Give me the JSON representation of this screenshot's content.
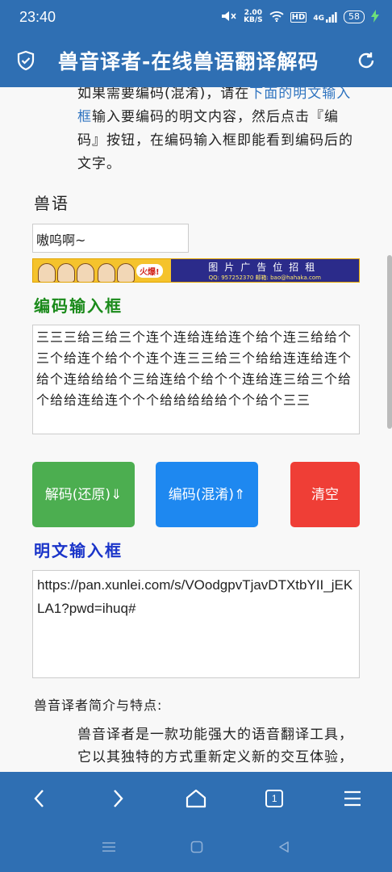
{
  "status": {
    "time": "23:40",
    "speed_value": "2.00",
    "speed_unit": "KB/S",
    "hd": "HD",
    "signal": "4G",
    "battery": "58"
  },
  "header": {
    "title": "兽音译者-在线兽语翻译解码"
  },
  "intro": {
    "part1": "如果需要编码(混淆)，请在",
    "link": "下面的明文输入框",
    "part2": "输入要编码的明文内容，然后点击『编码』按钮，在编码输入框即能看到编码后的文字。"
  },
  "beast_section": {
    "label": "兽语",
    "input_value": "嗷呜啊~"
  },
  "ad": {
    "hot": "火爆!",
    "text": "图片广告位招租",
    "contact": "QQ: 957252370  邮箱: bao@hahaka.com"
  },
  "encoded_section": {
    "label": "编码输入框",
    "value": "三三三给三给三个连个连给连给连个给个连三给给个三个给连个给个个连个连三三给三个给给连连给连个给个连给给给个三给连给个给个个连给连三给三个给个给给连给连个个个给给给给给个个给个三三"
  },
  "buttons": {
    "decode": "解码(还原)⇓",
    "encode": "编码(混淆)⇑",
    "clear": "清空"
  },
  "plain_section": {
    "label": "明文输入框",
    "value": "https://pan.xunlei.com/s/VOodgpvTjavDTXtbYII_jEKLA1?pwd=ihuq#"
  },
  "features": {
    "title": "兽音译者简介与特点:",
    "body": "兽音译者是一款功能强大的语音翻译工具，它以其独特的方式重新定义新的交互体验，带来全新的语言转换体验，让兽语变得通俗易懂。"
  },
  "bottom_nav": {
    "tab_count": "1"
  },
  "colors": {
    "primary": "#2f6fb3",
    "decode": "#4cae50",
    "encode": "#1e88f0",
    "clear": "#ef3e36",
    "encoded_label": "#1a8a1a",
    "plain_label": "#1a34c9"
  }
}
